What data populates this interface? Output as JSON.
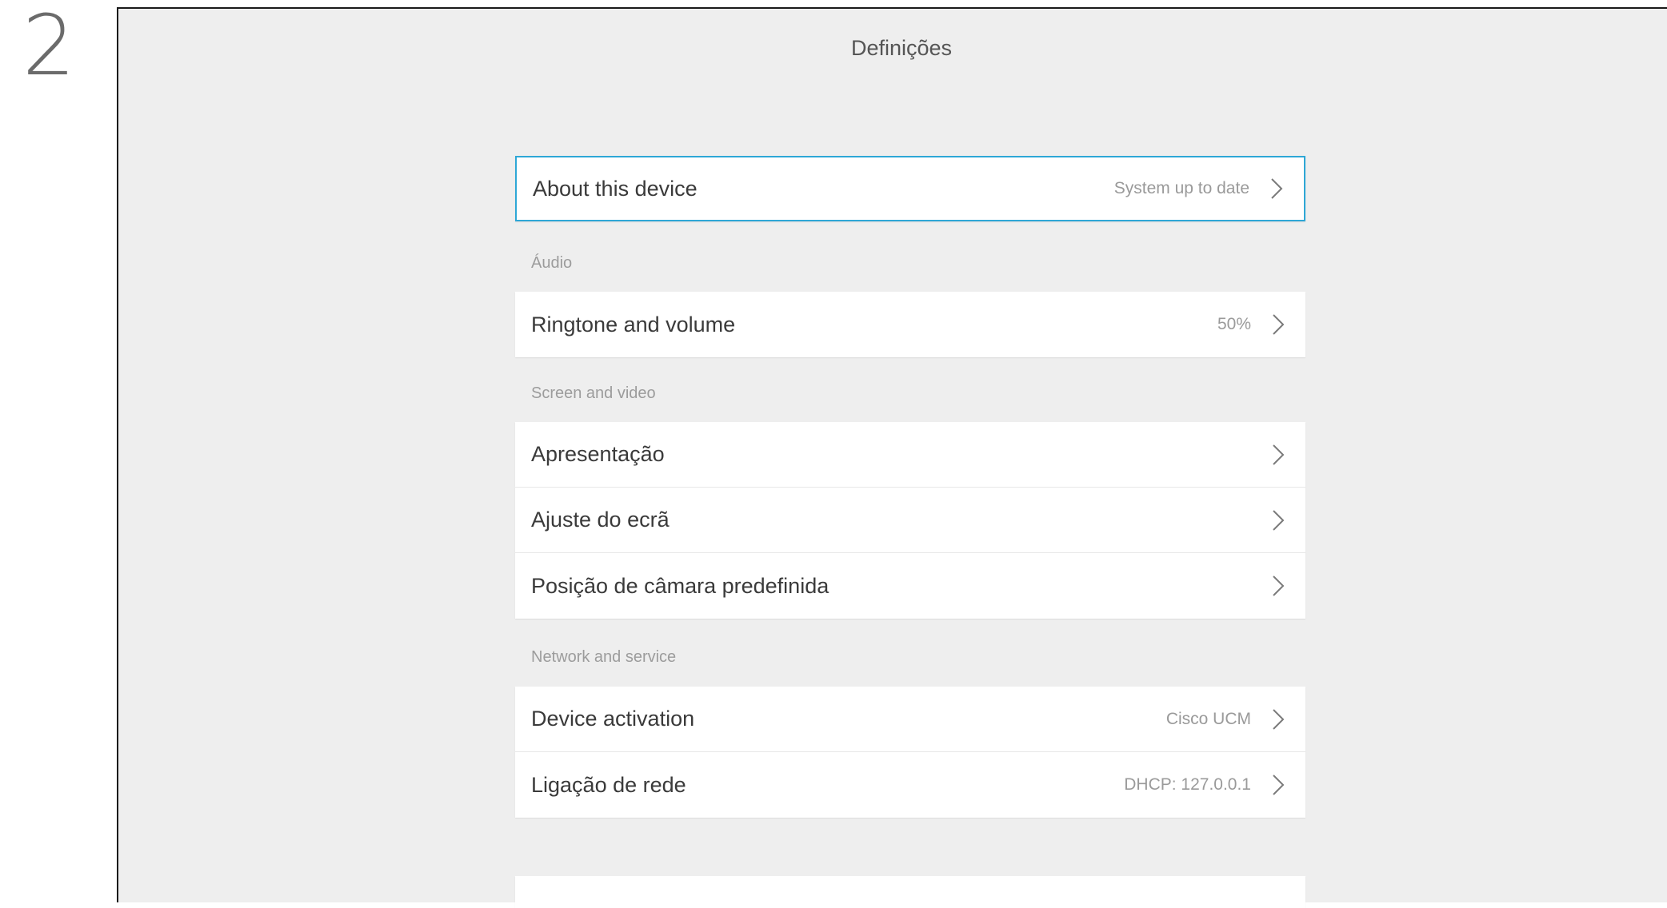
{
  "step": "2",
  "screen": {
    "title": "Definições"
  },
  "settings": {
    "about": {
      "label": "About this device",
      "value": "System up to date"
    },
    "audio_section": "Áudio",
    "ringtone": {
      "label": "Ringtone and volume",
      "value": "50%"
    },
    "screen_section": "Screen and video",
    "presentation": {
      "label": "Apresentação",
      "value": ""
    },
    "screen_adjust": {
      "label": "Ajuste do ecrã",
      "value": ""
    },
    "camera_preset": {
      "label": "Posição de câmara predefinida",
      "value": ""
    },
    "network_section": "Network and service",
    "device_activation": {
      "label": "Device activation",
      "value": "Cisco UCM"
    },
    "network_connection": {
      "label": "Ligação de rede",
      "value": "DHCP: 127.0.0.1"
    }
  },
  "colors": {
    "accent": "#2ea7d6",
    "background": "#eeeeee",
    "card": "#ffffff"
  }
}
